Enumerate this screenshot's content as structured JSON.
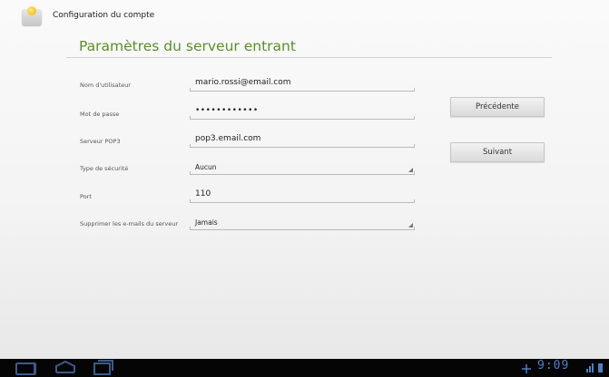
{
  "app_bar": {
    "title": "Configuration du compte",
    "icon": "email-account-icon"
  },
  "header": {
    "title": "Paramètres du serveur entrant"
  },
  "form": {
    "username_label": "Nom d'utilisateur",
    "username_value": "mario.rossi@email.com",
    "password_label": "Mot de passe",
    "password_value": "••••••••••••",
    "server_label": "Serveur POP3",
    "server_value": "pop3.email.com",
    "security_label": "Type de sécurité",
    "security_value": "Aucun",
    "port_label": "Port",
    "port_value": "110",
    "delete_label": "Supprimer les e-mails du serveur",
    "delete_value": "Jamais"
  },
  "buttons": {
    "previous": "Précédente",
    "next": "Suivant"
  },
  "status_bar": {
    "time": "9:09",
    "accent": "#4f7fc2"
  },
  "colors": {
    "header_accent": "#5b8d2c"
  }
}
